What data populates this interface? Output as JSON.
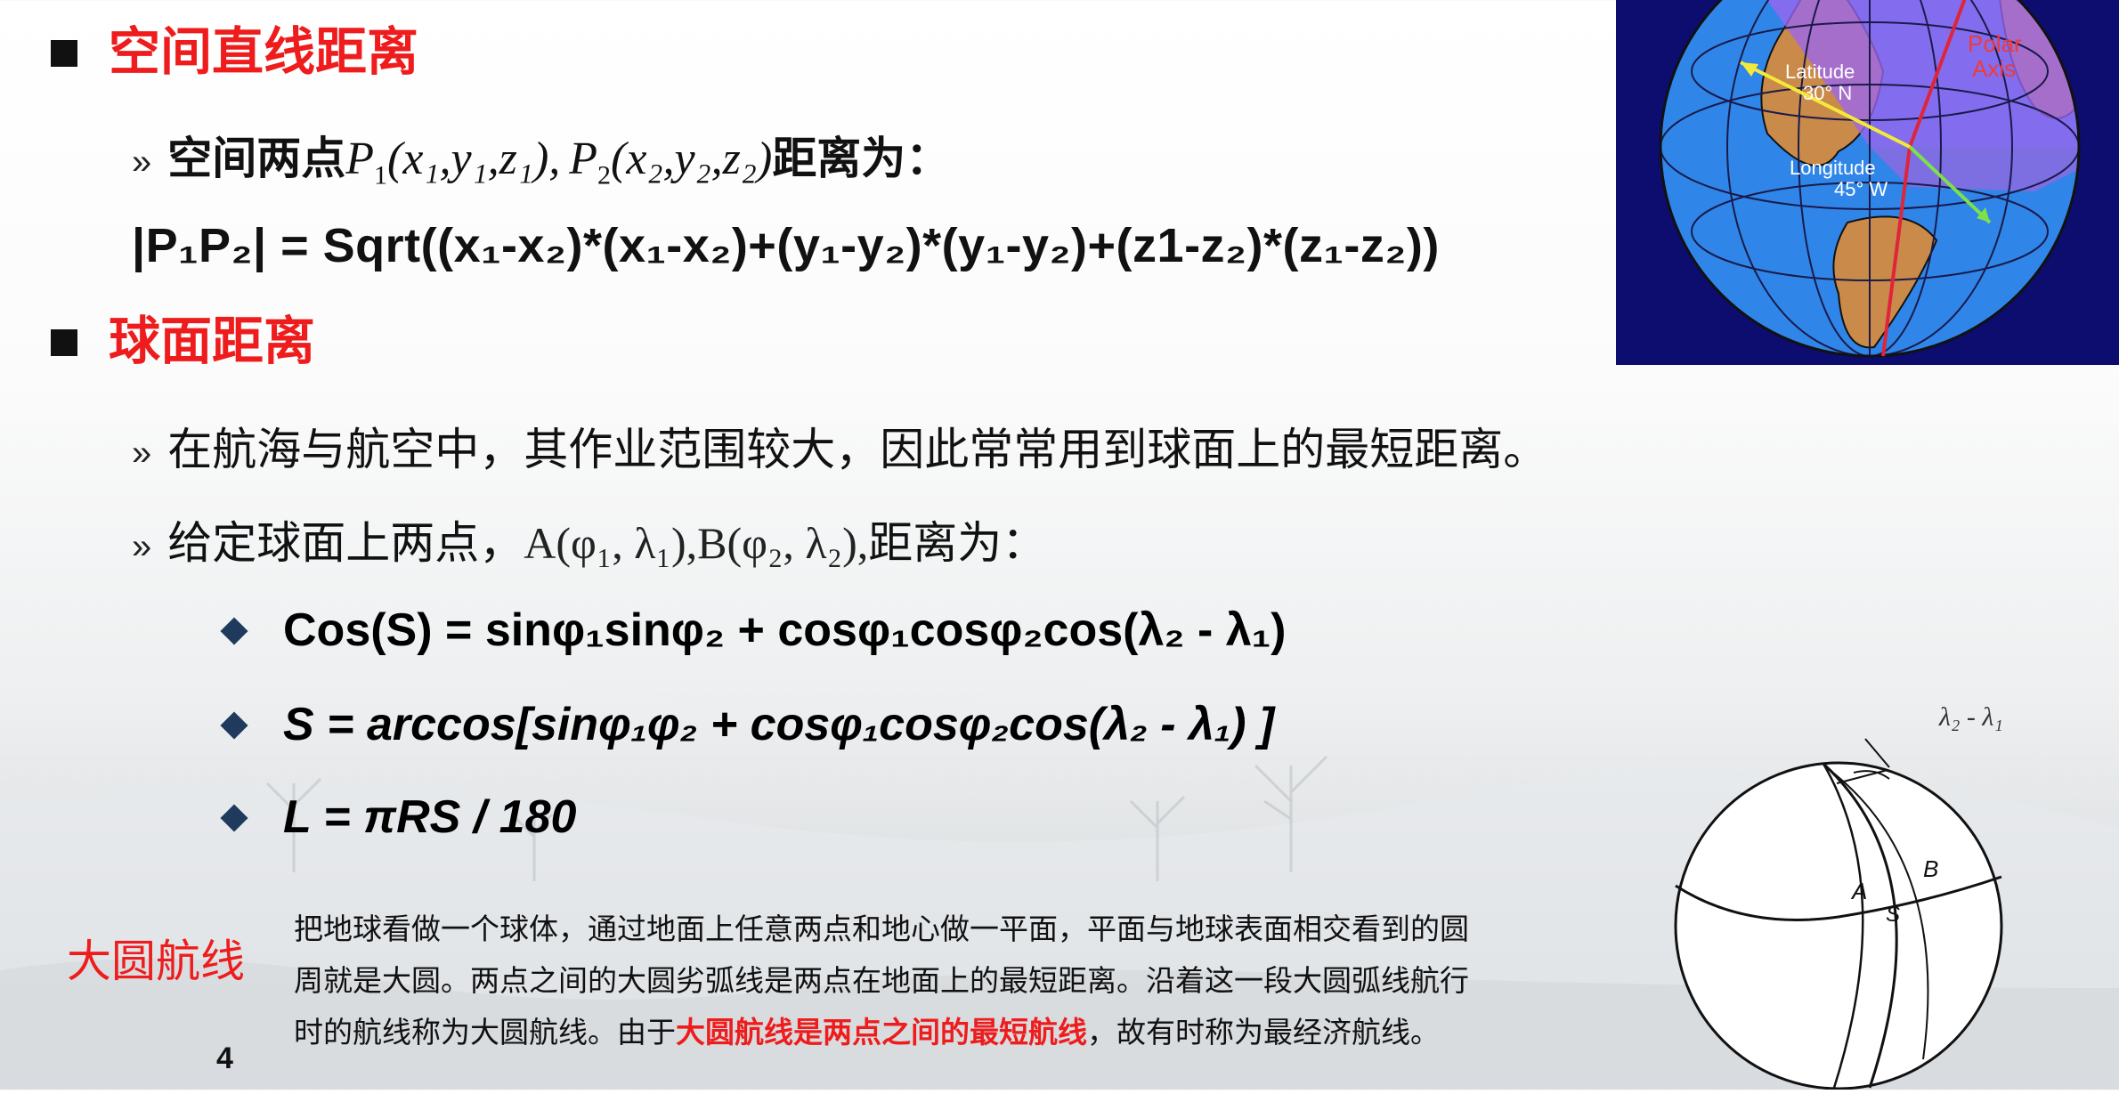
{
  "section1": {
    "title": "空间直线距离"
  },
  "line1": {
    "bullet": "»",
    "prefix": "空间两点",
    "P1": "P",
    "P1_sub": "1",
    "P1_args": "(x₁,y₁,z₁),",
    "P2": "P",
    "P2_sub": "2",
    "P2_args": "(x₂,y₂,z₂)",
    "suffix": "距离为："
  },
  "distance_formula": "|P₁P₂| = Sqrt((x₁-x₂)*(x₁-x₂)+(y₁-y₂)*(y₁-y₂)+(z1-z₂)*(z₁-z₂))",
  "section2": {
    "title": "球面距离"
  },
  "line2": {
    "bullet": "»",
    "text": "在航海与航空中，其作业范围较大，因此常常用到球面上的最短距离。"
  },
  "line3": {
    "bullet": "»",
    "prefix": "给定球面上两点，",
    "points": "A(φ₁, λ₁),B(φ₂, λ₂),",
    "suffix": "距离为："
  },
  "formulas": [
    "Cos(S) = sinφ₁sinφ₂ + cosφ₁cosφ₂cos(λ₂ - λ₁)",
    "S = arccos[sinφ₁φ₂ + cosφ₁cosφ₂cos(λ₂ - λ₁) ]",
    "L = πRS / 180"
  ],
  "great_circle": {
    "label": "大圆航线",
    "line1": "把地球看做一个球体，通过地面上任意两点和地心做一平面，平面与地球表面相交看到的圆",
    "line2": "周就是大圆。两点之间的大圆劣弧线是两点在地面上的最短距离。沿着这一段大圆弧线航行",
    "line3_before": "时的航线称为大圆航线。由于",
    "line3_highlight": "大圆航线是两点之间的最短航线",
    "line3_after": "，故有时称为最经济航线。"
  },
  "page_number": "4",
  "globe_figure": {
    "polar_axis": [
      "Polar",
      "Axis"
    ],
    "latitude": [
      "Latitude",
      "30° N"
    ],
    "longitude": [
      "Longitude",
      "45° W"
    ]
  },
  "sphere_figure": {
    "angle_label": "λ₂ - λ₁",
    "point_a": "A",
    "point_b": "B",
    "arc_s": "S"
  },
  "colors": {
    "title_red": "#ee1c1c",
    "text": "#111111",
    "globe_bg": "#0c0d6e",
    "diamond": "#1f3a5c"
  }
}
